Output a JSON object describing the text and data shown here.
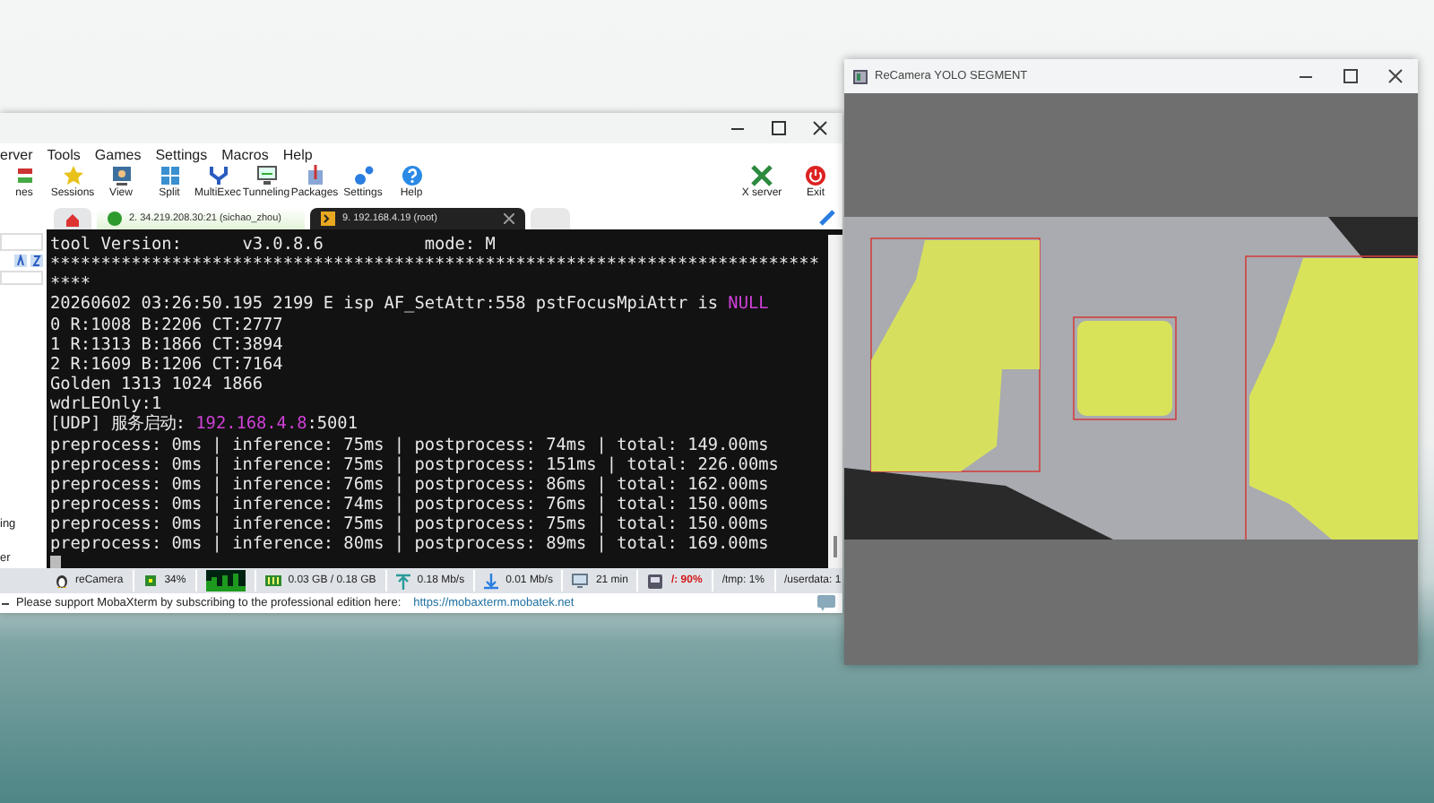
{
  "mobaxterm": {
    "menu": [
      "erver",
      "Tools",
      "Games",
      "Settings",
      "Macros",
      "Help"
    ],
    "toolbar": [
      {
        "label": "nes",
        "kind": "servers"
      },
      {
        "label": "Sessions",
        "kind": "star"
      },
      {
        "label": "View",
        "kind": "view"
      },
      {
        "label": "Split",
        "kind": "split"
      },
      {
        "label": "MultiExec",
        "kind": "fork"
      },
      {
        "label": "Tunneling",
        "kind": "monitor"
      },
      {
        "label": "Packages",
        "kind": "package"
      },
      {
        "label": "Settings",
        "kind": "gears"
      },
      {
        "label": "Help",
        "kind": "help"
      }
    ],
    "toolbar_right": [
      {
        "label": "X server",
        "kind": "x"
      },
      {
        "label": "Exit",
        "kind": "power"
      }
    ],
    "tabs": [
      {
        "kind": "home",
        "selected": false
      },
      {
        "kind": "ftp",
        "label": "2. 34.219.208.30:21 (sichao_zhou)",
        "selected": false
      },
      {
        "kind": "ssh",
        "label": "9. 192.168.4.19 (root)",
        "selected": true
      },
      {
        "kind": "new",
        "selected": false
      }
    ],
    "sidebar": {
      "items": [
        "ing",
        "er"
      ]
    },
    "terminal": {
      "lines": [
        [
          {
            "text": "tool Version:      v3.0.8.6          mode: M",
            "highlight": false
          }
        ],
        [
          {
            "text": "****************************************************************************",
            "highlight": false
          }
        ],
        [
          {
            "text": "****",
            "highlight": false
          }
        ],
        [
          {
            "text": "20260602 03:26:50.195 2199 E isp AF_SetAttr:558 pstFocusMpiAttr is ",
            "highlight": false
          },
          {
            "text": "NULL",
            "highlight": true
          }
        ],
        [
          {
            "text": "0 R:1008 B:2206 CT:2777",
            "highlight": false
          }
        ],
        [
          {
            "text": "1 R:1313 B:1866 CT:3894",
            "highlight": false
          }
        ],
        [
          {
            "text": "2 R:1609 B:1206 CT:7164",
            "highlight": false
          }
        ],
        [
          {
            "text": "Golden 1313 1024 1866",
            "highlight": false
          }
        ],
        [
          {
            "text": "wdrLEOnly:1",
            "highlight": false
          }
        ],
        [
          {
            "text": "[UDP] 服务启动: ",
            "highlight": false
          },
          {
            "text": "192.168.4.8",
            "highlight": true
          },
          {
            "text": ":5001",
            "highlight": false
          }
        ],
        [
          {
            "text": "preprocess: 0ms | inference: 75ms | postprocess: 74ms | total: 149.00ms",
            "highlight": false
          }
        ],
        [
          {
            "text": "preprocess: 0ms | inference: 75ms | postprocess: 151ms | total: 226.00ms",
            "highlight": false
          }
        ],
        [
          {
            "text": "preprocess: 0ms | inference: 76ms | postprocess: 86ms | total: 162.00ms",
            "highlight": false
          }
        ],
        [
          {
            "text": "preprocess: 0ms | inference: 74ms | postprocess: 76ms | total: 150.00ms",
            "highlight": false
          }
        ],
        [
          {
            "text": "preprocess: 0ms | inference: 75ms | postprocess: 75ms | total: 150.00ms",
            "highlight": false
          }
        ],
        [
          {
            "text": "preprocess: 0ms | inference: 80ms | postprocess: 89ms | total: 169.00ms",
            "highlight": false
          }
        ]
      ]
    },
    "status_bar": [
      {
        "kind": "host",
        "text": "reCamera",
        "warning": false
      },
      {
        "kind": "cpu",
        "text": "34%",
        "warning": false
      },
      {
        "kind": "graph"
      },
      {
        "kind": "memory",
        "text": "0.03 GB / 0.18 GB",
        "warning": false
      },
      {
        "kind": "upload",
        "text": "0.18 Mb/s",
        "warning": false
      },
      {
        "kind": "download",
        "text": "0.01 Mb/s",
        "warning": false
      },
      {
        "kind": "uptime",
        "text": "21 min",
        "warning": false
      },
      {
        "kind": "disk",
        "text": "/: 90%",
        "warning": true
      },
      {
        "kind": "plain",
        "text": "/tmp: 1%",
        "warning": false
      },
      {
        "kind": "plain",
        "text": "/userdata: 1",
        "warning": false
      }
    ],
    "notice": {
      "text": "Please support MobaXterm by subscribing to the professional edition here:",
      "link": "https://mobaxterm.mobatek.net"
    }
  },
  "camera_window": {
    "title": "ReCamera YOLO SEGMENT"
  }
}
